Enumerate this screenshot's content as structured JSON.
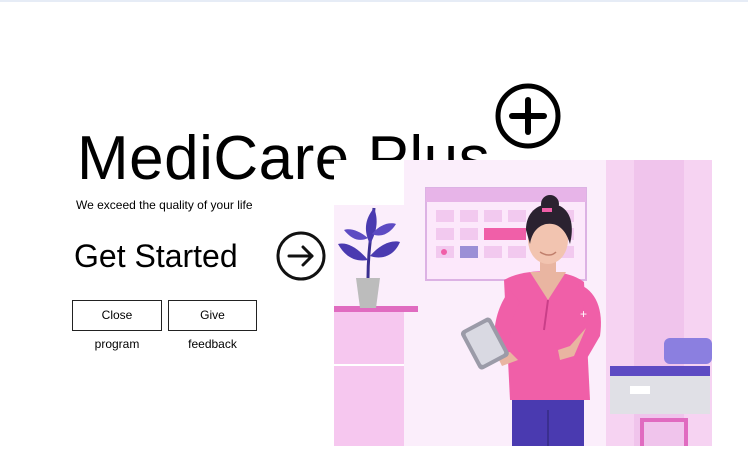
{
  "brand": {
    "title": "MediCare Plus",
    "tagline": "We exceed the quality of your life"
  },
  "hero": {
    "cta_label": "Get Started"
  },
  "buttons": {
    "close_label": "Close program",
    "feedback_label": "Give feedback"
  },
  "icons": {
    "plus": "circled-plus-icon",
    "arrow": "circled-arrow-right-icon"
  },
  "colors": {
    "pink_main": "#f05fa8",
    "pink_light": "#f7d6f3",
    "purple": "#4a3ab0",
    "background": "#ffffff"
  }
}
